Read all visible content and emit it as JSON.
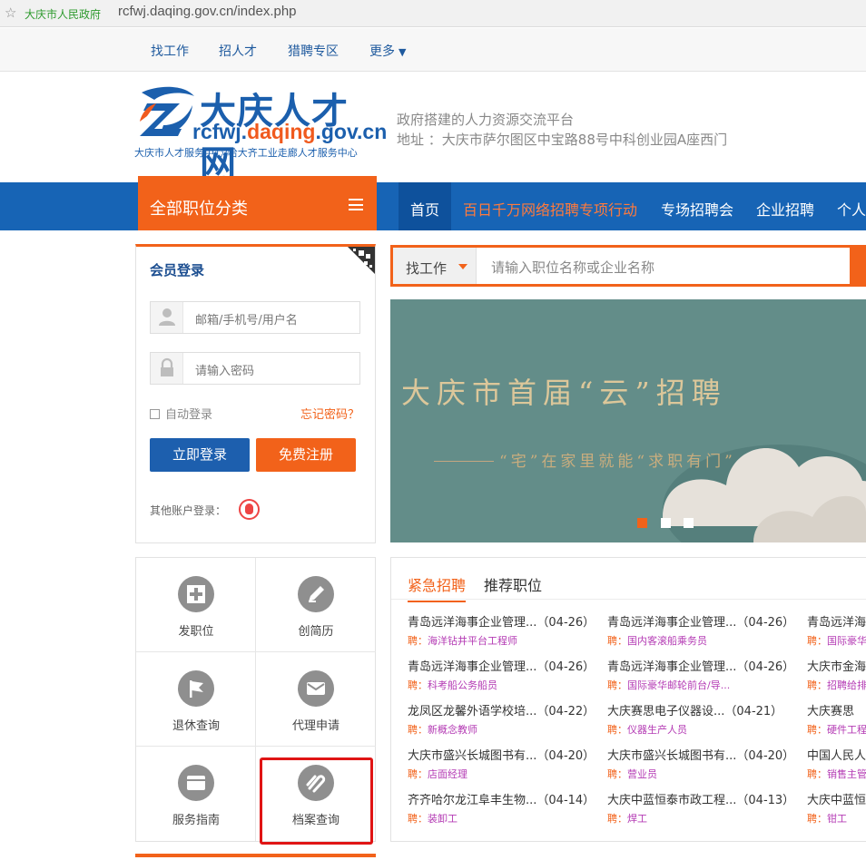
{
  "browser": {
    "site_label": "大庆市人民政府",
    "url": "rcfwj.daqing.gov.cn/index.php"
  },
  "topnav": {
    "items": [
      "找工作",
      "招人才",
      "猎聘专区",
      "更多"
    ]
  },
  "header": {
    "logo_title": "大庆人才网",
    "logo_url_prefix": "rcfwj.",
    "logo_url_brand": "daqing",
    "logo_url_suffix": ".gov.cn",
    "logo_sub": "大庆市人才服务中心/哈大齐工业走廊人才服务中心",
    "slogan": "政府搭建的人力资源交流平台",
    "address": "地址 ：大庆市萨尔图区中宝路88号中科创业园A座西门"
  },
  "mainnav": {
    "category_label": "全部职位分类",
    "items": [
      "首页",
      "百日千万网络招聘专项行动",
      "专场招聘会",
      "企业招聘",
      "个人"
    ]
  },
  "login": {
    "title": "会员登录",
    "username_placeholder": "邮箱/手机号/用户名",
    "password_placeholder": "请输入密码",
    "auto_login": "自动登录",
    "forgot": "忘记密码？",
    "login_button": "立即登录",
    "register_button": "免费注册",
    "other_login": "其他账户登录："
  },
  "services": [
    {
      "label": "发职位",
      "icon": "plus-icon"
    },
    {
      "label": "创简历",
      "icon": "pencil-icon"
    },
    {
      "label": "退休查询",
      "icon": "flag-icon"
    },
    {
      "label": "代理申请",
      "icon": "mail-icon"
    },
    {
      "label": "服务指南",
      "icon": "calendar-icon"
    },
    {
      "label": "档案查询",
      "icon": "paperclip-icon"
    }
  ],
  "search": {
    "type": "找工作",
    "placeholder": "请输入职位名称或企业名称"
  },
  "banner": {
    "headline": "大庆市首届“云”招聘",
    "subline": "“宅”在家里就能“求职有门”"
  },
  "jobs": {
    "tabs": [
      "紧急招聘",
      "推荐职位"
    ],
    "role_prefix": "聘：",
    "rows": [
      [
        {
          "company": "青岛远洋海事企业管理...",
          "date": "（04-26）",
          "role": "海洋钻井平台工程师"
        },
        {
          "company": "青岛远洋海事企业管理...",
          "date": "（04-26）",
          "role": "国内客滚船乘务员"
        },
        {
          "company": "青岛远洋海",
          "date": "",
          "role": "国际豪华"
        }
      ],
      [
        {
          "company": "青岛远洋海事企业管理...",
          "date": "（04-26）",
          "role": "科考船公务船员"
        },
        {
          "company": "青岛远洋海事企业管理...",
          "date": "（04-26）",
          "role": "国际豪华邮轮前台/导..."
        },
        {
          "company": "大庆市金海",
          "date": "",
          "role": "招聘给排"
        }
      ],
      [
        {
          "company": "龙凤区龙馨外语学校培...",
          "date": "（04-22）",
          "role": "新概念教师"
        },
        {
          "company": "大庆赛思电子仪器设...",
          "date": "（04-21）",
          "role": "仪器生产人员"
        },
        {
          "company": "大庆赛思",
          "date": "",
          "role": "硬件工程"
        }
      ],
      [
        {
          "company": "大庆市盛兴长城图书有...",
          "date": "（04-20）",
          "role": "店面经理"
        },
        {
          "company": "大庆市盛兴长城图书有...",
          "date": "（04-20）",
          "role": "营业员"
        },
        {
          "company": "中国人民人",
          "date": "",
          "role": "销售主管"
        }
      ],
      [
        {
          "company": "齐齐哈尔龙江阜丰生物...",
          "date": "（04-14）",
          "role": "装卸工"
        },
        {
          "company": "大庆中蓝恒泰市政工程...",
          "date": "（04-13）",
          "role": "焊工"
        },
        {
          "company": "大庆中蓝恒",
          "date": "",
          "role": "钳工"
        }
      ]
    ]
  }
}
